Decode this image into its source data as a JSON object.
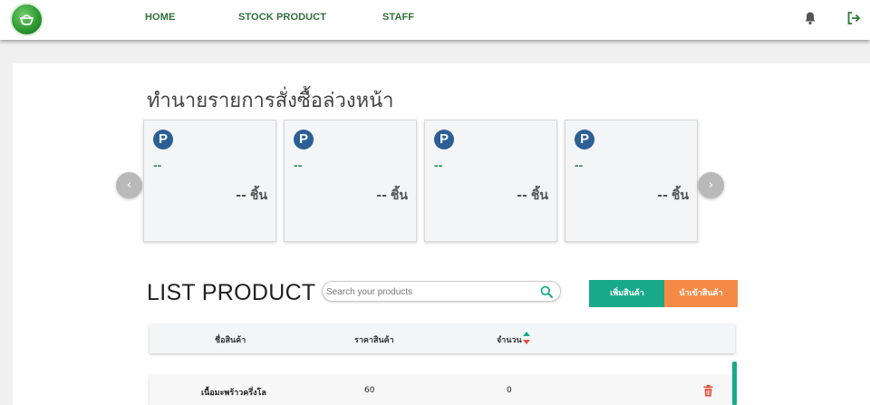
{
  "nav": {
    "home": "HOME",
    "stock": "STOCK PRODUCT",
    "staff": "STAFF"
  },
  "forecast": {
    "title": "ทำนายรายการสั่งซื้อล่วงหน้า",
    "cards": [
      {
        "badge": "P",
        "name": "--",
        "qty": "--",
        "unit": "ชิ้น"
      },
      {
        "badge": "P",
        "name": "--",
        "qty": "--",
        "unit": "ชิ้น"
      },
      {
        "badge": "P",
        "name": "--",
        "qty": "--",
        "unit": "ชิ้น"
      },
      {
        "badge": "P",
        "name": "--",
        "qty": "--",
        "unit": "ชิ้น"
      }
    ],
    "prev_icon": "‹",
    "next_icon": "›"
  },
  "list": {
    "title": "LIST PRODUCT",
    "search_placeholder": "Search your products",
    "search_value": "",
    "add_button": "เพิ่มสินค้า",
    "import_button": "นำเข้าสินค้า",
    "columns": {
      "name": "ชื่อสินค้า",
      "price": "ราคาสินค้า",
      "quantity": "จำนวน"
    },
    "rows": [
      {
        "name": "เนื้อมะพร้าวครึ่งโล",
        "price": "60",
        "quantity": "0"
      }
    ]
  },
  "icons": {
    "logo": "logo-icon",
    "bell": "bell-icon",
    "logout": "logout-icon",
    "search": "search-icon",
    "sort": "sort-icon",
    "delete": "trash-icon"
  },
  "colors": {
    "nav_text": "#2f6f3a",
    "badge": "#2b5f95",
    "placeholder_name": "#2e8b57",
    "add_button": "#17a98a",
    "import_button": "#f58a45",
    "delete": "#e0533d"
  }
}
